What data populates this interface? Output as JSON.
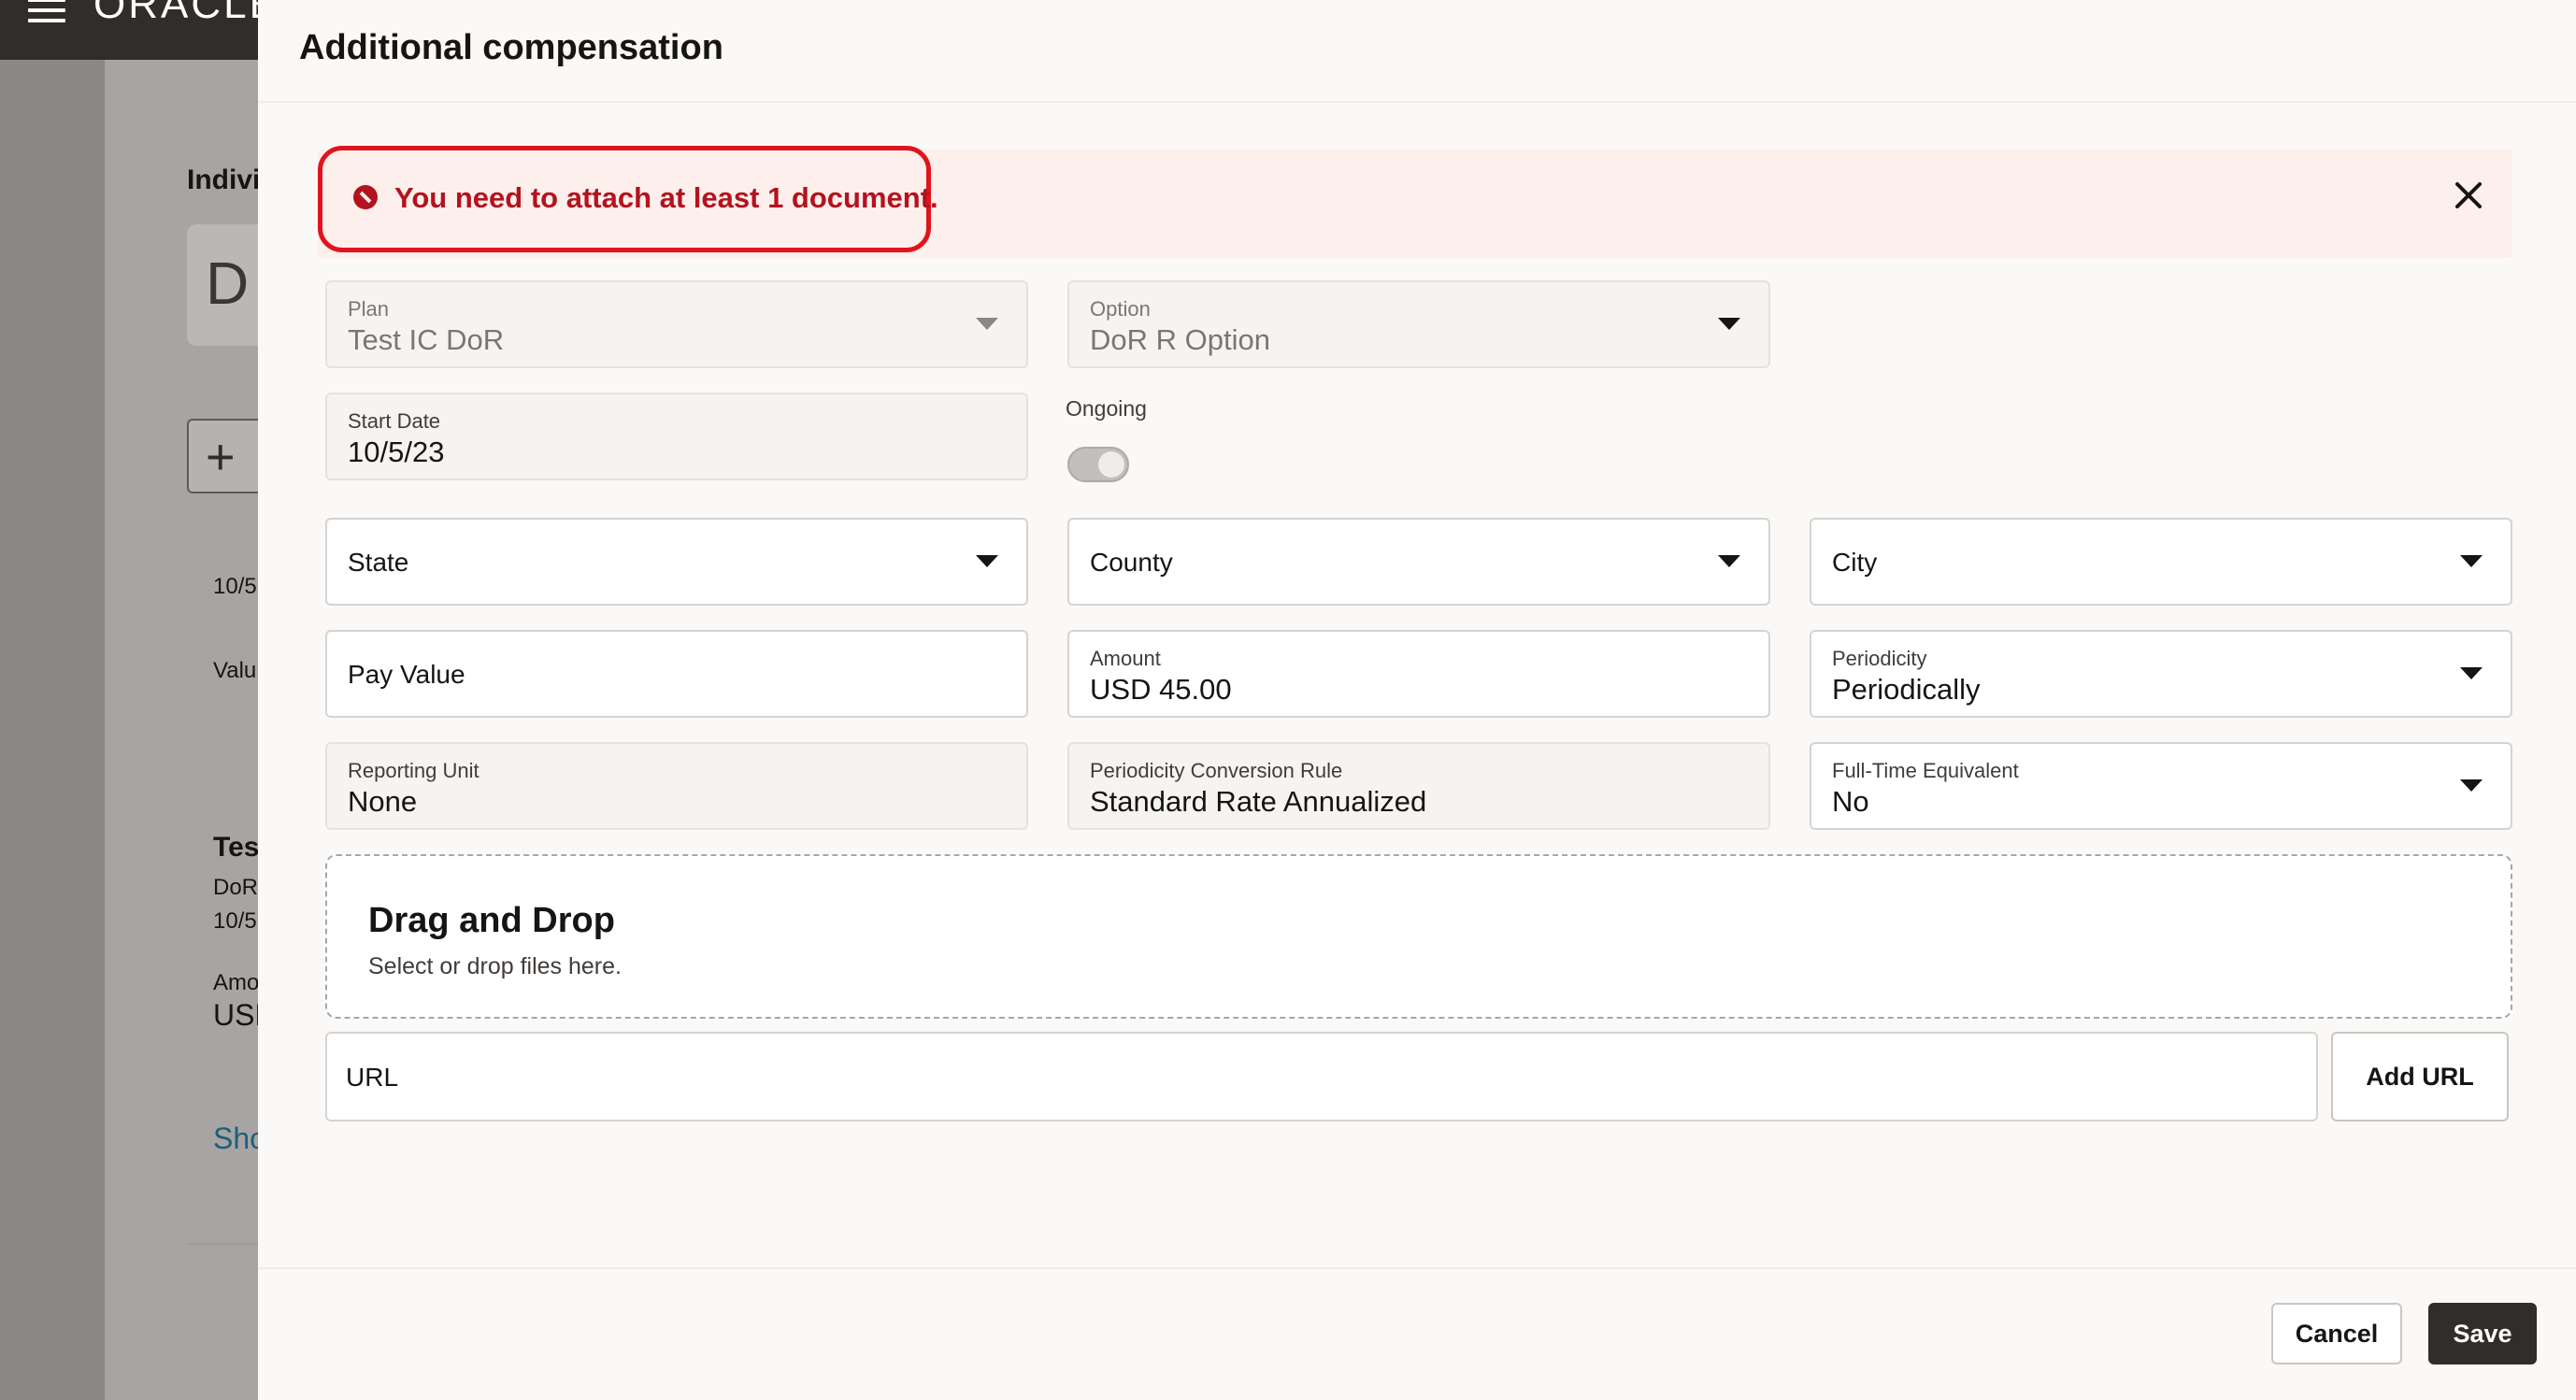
{
  "background": {
    "logo": "ORACLE",
    "stripe_colors": [
      "#c74634",
      "#8c6a5b",
      "#5b9b9a",
      "#d2a26a"
    ],
    "heading": "Indivi",
    "avatar_letters": "D",
    "date1": "10/5",
    "value_label": "Valu",
    "card_title": "Tes",
    "card_line1": "DoR",
    "card_line2": "10/5",
    "amount_label": "Amo",
    "amount_value": "USD",
    "link": "Sho"
  },
  "drawer": {
    "title": "Additional compensation",
    "error_message": "You need to attach at least 1 document.",
    "fields": {
      "plan": {
        "label": "Plan",
        "value": "Test IC DoR"
      },
      "option": {
        "label": "Option",
        "value": "DoR R Option"
      },
      "start_date": {
        "label": "Start Date",
        "value": "10/5/23"
      },
      "ongoing": {
        "label": "Ongoing",
        "checked": false
      },
      "state": {
        "label": "State"
      },
      "county": {
        "label": "County"
      },
      "city": {
        "label": "City"
      },
      "pay_value": {
        "label": "Pay Value"
      },
      "amount": {
        "label": "Amount",
        "value": "USD 45.00"
      },
      "periodicity": {
        "label": "Periodicity",
        "value": "Periodically"
      },
      "reporting_unit": {
        "label": "Reporting Unit",
        "value": "None"
      },
      "periodicity_conversion_rule": {
        "label": "Periodicity Conversion Rule",
        "value": "Standard Rate Annualized"
      },
      "fte": {
        "label": "Full-Time Equivalent",
        "value": "No"
      }
    },
    "dropzone": {
      "title": "Drag and Drop",
      "subtitle": "Select or drop files here."
    },
    "url": {
      "placeholder": "URL",
      "add_label": "Add URL"
    },
    "actions": {
      "cancel": "Cancel",
      "save": "Save"
    }
  },
  "colors": {
    "error": "#b3131e",
    "highlight": "#e0141e",
    "primary_button": "#312d2a"
  }
}
